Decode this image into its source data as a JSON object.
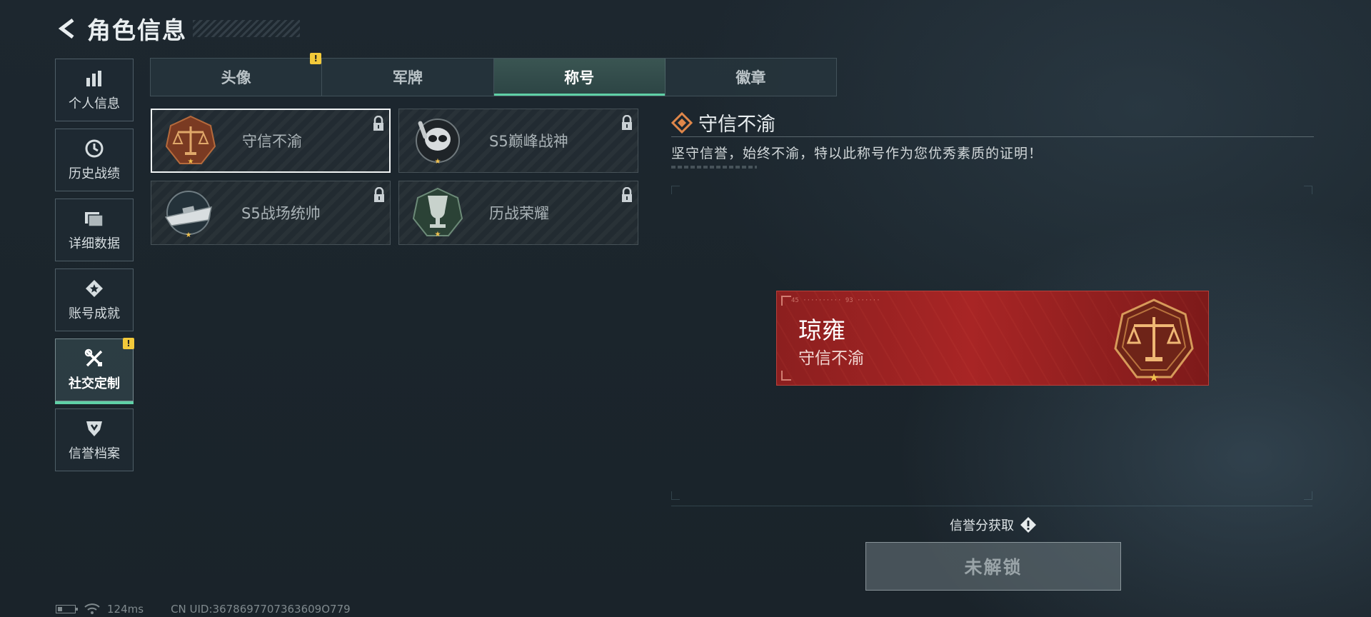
{
  "header": {
    "title": "角色信息"
  },
  "sidebar": {
    "items": [
      {
        "label": "个人信息",
        "icon": "bar-chart-icon"
      },
      {
        "label": "历史战绩",
        "icon": "history-clock-icon"
      },
      {
        "label": "详细数据",
        "icon": "folder-icon"
      },
      {
        "label": "账号成就",
        "icon": "achievement-icon"
      },
      {
        "label": "社交定制",
        "icon": "tools-icon",
        "active": true,
        "badge": "!"
      },
      {
        "label": "信誉档案",
        "icon": "shield-icon"
      }
    ]
  },
  "tabs": [
    {
      "label": "头像",
      "badge": "!"
    },
    {
      "label": "军牌"
    },
    {
      "label": "称号",
      "active": true
    },
    {
      "label": "徽章"
    }
  ],
  "titles": [
    {
      "name": "守信不渝",
      "badge_icon": "scales-emblem-icon",
      "locked": true,
      "selected": true
    },
    {
      "name": "S5巅峰战神",
      "badge_icon": "diver-skull-emblem-icon",
      "locked": true
    },
    {
      "name": "S5战场统帅",
      "badge_icon": "boat-emblem-icon",
      "locked": true
    },
    {
      "name": "历战荣耀",
      "badge_icon": "trophy-emblem-icon",
      "locked": true
    }
  ],
  "detail": {
    "title": "守信不渝",
    "description": "坚守信誉，始终不渝，特以此称号作为您优秀素质的证明！"
  },
  "preview": {
    "player_name": "琼雍",
    "title": "守信不渝",
    "code_text": "45 ·········· 93 ······",
    "color": "#a82525"
  },
  "credit": {
    "label": "信誉分获取"
  },
  "unlock_button": {
    "label": "未解锁"
  },
  "status": {
    "ping": "124ms",
    "uid": "CN UID:3678697707363609O779"
  },
  "colors": {
    "accent": "#5fd0a6",
    "warning": "#f2c93a"
  }
}
